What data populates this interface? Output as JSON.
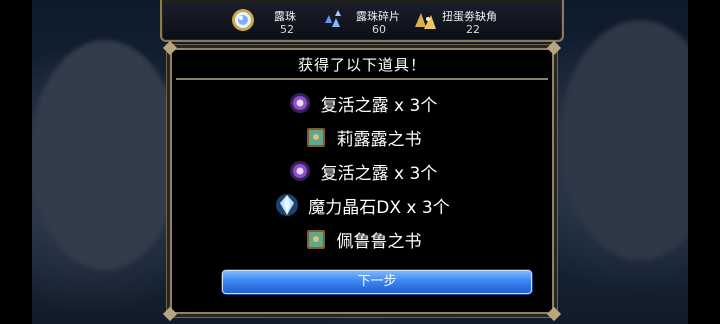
{
  "resources": [
    {
      "icon": "dew-pearl-icon",
      "name": "露珠",
      "value": "52"
    },
    {
      "icon": "dew-fragment-icon",
      "name": "露珠碎片",
      "value": "60"
    },
    {
      "icon": "gacha-ticket-corner-icon",
      "name": "扭蛋劵缺角",
      "value": "22"
    }
  ],
  "dialog": {
    "title": "获得了以下道具！",
    "items": [
      {
        "icon": "purple-orb-icon",
        "text": "复活之露 x 3个"
      },
      {
        "icon": "book-icon",
        "text": "莉露露之书"
      },
      {
        "icon": "purple-orb-icon",
        "text": "复活之露 x 3个"
      },
      {
        "icon": "crystal-icon",
        "text": "魔力晶石DX x 3个"
      },
      {
        "icon": "book-icon",
        "text": "佩鲁鲁之书"
      }
    ],
    "next_label": "下一步"
  },
  "colors": {
    "frame": "#8f826a",
    "button": "#3d86f2",
    "background": "#1a2a3d"
  }
}
